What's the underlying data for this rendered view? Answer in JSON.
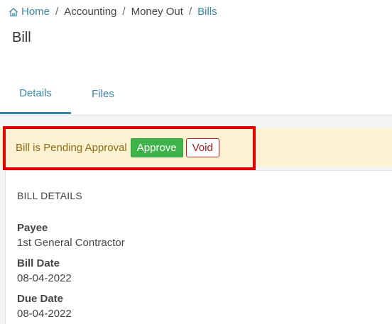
{
  "breadcrumb": {
    "home": "Home",
    "items": [
      "Accounting",
      "Money Out",
      "Bills"
    ],
    "separator": "/"
  },
  "page": {
    "title": "Bill"
  },
  "tabs": [
    {
      "label": "Details",
      "active": true
    },
    {
      "label": "Files",
      "active": false
    }
  ],
  "alert": {
    "message": "Bill is Pending Approval",
    "approve_label": "Approve",
    "void_label": "Void"
  },
  "bill_details": {
    "header": "BILL DETAILS",
    "payee_label": "Payee",
    "payee_value": "1st General Contractor",
    "bill_date_label": "Bill Date",
    "bill_date_value": "08-04-2022",
    "due_date_label": "Due Date",
    "due_date_value": "08-04-2022"
  },
  "colors": {
    "link": "#3a86a8",
    "alert_bg": "#fdf3d3",
    "alert_text": "#8a6a12",
    "approve": "#3fb24a",
    "void": "#a11b1b",
    "highlight": "#e00000"
  }
}
